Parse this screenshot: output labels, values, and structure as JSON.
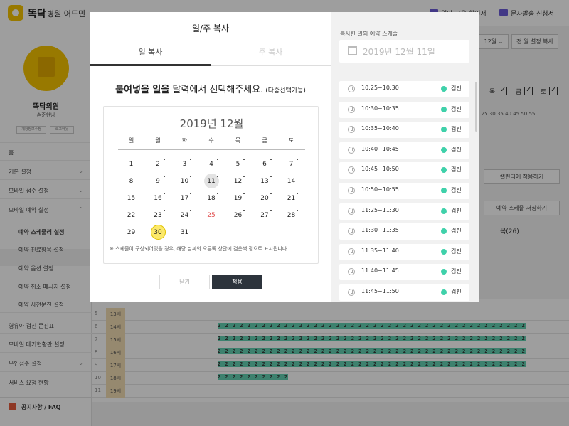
{
  "app": {
    "name": "똑닥",
    "subtitle": "병원 어드민"
  },
  "topbar": {
    "link1": "워아 교육 확인서",
    "link2": "문자발송 신청서"
  },
  "profile": {
    "clinic": "똑닥의원",
    "doctor": "손준현님",
    "btn1": "계정정보수정",
    "btn2": "로그아웃"
  },
  "sidebar": {
    "items": [
      {
        "label": "홈"
      },
      {
        "label": "기본 설정"
      },
      {
        "label": "모바일 접수 설정"
      },
      {
        "label": "모바일 예약 설정"
      },
      {
        "label": "예약 스케줄러 설정"
      },
      {
        "label": "예약 진료항목 설정"
      },
      {
        "label": "예약 옵션 설정"
      },
      {
        "label": "예약 취소 메시지 설정"
      },
      {
        "label": "예약 사전문진 설정"
      },
      {
        "label": "영유아 검진 문진표"
      },
      {
        "label": "모바일 대기현황판 설정"
      },
      {
        "label": "무인접수 설정"
      },
      {
        "label": "서비스 요청 현황"
      }
    ],
    "notice": "공지사항 / FAQ"
  },
  "background": {
    "month_select": "12월",
    "copy_btn": "전 월 설정 복사",
    "weekdays": [
      "목",
      "금",
      "토"
    ],
    "minutes": "0 25 30 35 40 45 50 55",
    "calendar_apply": "캘린더에 적용하기",
    "save_schedule": "예약 스케줄 저장하기",
    "thu_label": "목(26)",
    "rows": [
      {
        "num": "5",
        "time": "13시"
      },
      {
        "num": "6",
        "time": "14시"
      },
      {
        "num": "7",
        "time": "15시"
      },
      {
        "num": "8",
        "time": "16시"
      },
      {
        "num": "9",
        "time": "17시"
      },
      {
        "num": "10",
        "time": "18시"
      },
      {
        "num": "11",
        "time": "19시"
      }
    ]
  },
  "modal": {
    "title": "일/주 복사",
    "tabs": [
      "일 복사",
      "주 복사"
    ],
    "instruction_strong": "붙여넣을 일을",
    "instruction_rest": " 달력에서 선택해주세요.",
    "instruction_small": " (다중선택가능)",
    "calendar": {
      "title": "2019년 12월",
      "dow": [
        "일",
        "월",
        "화",
        "수",
        "목",
        "금",
        "토"
      ],
      "weeks": [
        [
          {
            "d": "1",
            "dot": false
          },
          {
            "d": "2",
            "dot": true
          },
          {
            "d": "3",
            "dot": true
          },
          {
            "d": "4",
            "dot": true
          },
          {
            "d": "5",
            "dot": true
          },
          {
            "d": "6",
            "dot": true
          },
          {
            "d": "7",
            "dot": true
          }
        ],
        [
          {
            "d": "8",
            "dot": false
          },
          {
            "d": "9",
            "dot": true
          },
          {
            "d": "10",
            "dot": true
          },
          {
            "d": "11",
            "dot": true,
            "state": "source"
          },
          {
            "d": "12",
            "dot": true
          },
          {
            "d": "13",
            "dot": true
          },
          {
            "d": "14",
            "dot": false
          }
        ],
        [
          {
            "d": "15",
            "dot": false
          },
          {
            "d": "16",
            "dot": true
          },
          {
            "d": "17",
            "dot": true
          },
          {
            "d": "18",
            "dot": true
          },
          {
            "d": "19",
            "dot": true
          },
          {
            "d": "20",
            "dot": true
          },
          {
            "d": "21",
            "dot": true
          }
        ],
        [
          {
            "d": "22",
            "dot": false
          },
          {
            "d": "23",
            "dot": true
          },
          {
            "d": "24",
            "dot": true
          },
          {
            "d": "25",
            "dot": false,
            "state": "holiday"
          },
          {
            "d": "26",
            "dot": true
          },
          {
            "d": "27",
            "dot": true
          },
          {
            "d": "28",
            "dot": true
          }
        ],
        [
          {
            "d": "29",
            "dot": false
          },
          {
            "d": "30",
            "dot": false,
            "state": "selected"
          },
          {
            "d": "31",
            "dot": false
          }
        ]
      ],
      "note": "※ 스케줄이 구성되어있을 경우, 해당 날짜의 오른쪽 상단에 검은색 점으로 표시됩니다."
    },
    "buttons": {
      "close": "닫기",
      "apply": "적용"
    },
    "right": {
      "label": "복사한 일의 예약 스케줄",
      "date": "2019년 12월 11일",
      "slots": [
        {
          "time": "10:25~10:30",
          "status": "검진"
        },
        {
          "time": "10:30~10:35",
          "status": "검진"
        },
        {
          "time": "10:35~10:40",
          "status": "검진"
        },
        {
          "time": "10:40~10:45",
          "status": "검진"
        },
        {
          "time": "10:45~10:50",
          "status": "검진"
        },
        {
          "time": "10:50~10:55",
          "status": "검진"
        },
        {
          "time": "11:25~11:30",
          "status": "검진"
        },
        {
          "time": "11:30~11:35",
          "status": "검진"
        },
        {
          "time": "11:35~11:40",
          "status": "검진"
        },
        {
          "time": "11:40~11:45",
          "status": "검진"
        },
        {
          "time": "11:45~11:50",
          "status": "검진"
        }
      ]
    }
  },
  "colors": {
    "brand": "#f5c400",
    "accent_green": "#3fd1aa",
    "holiday_red": "#e04848",
    "source_gray": "#e3e3e3",
    "selected_yellow": "#fce96a",
    "apply_btn": "#2d343c"
  }
}
